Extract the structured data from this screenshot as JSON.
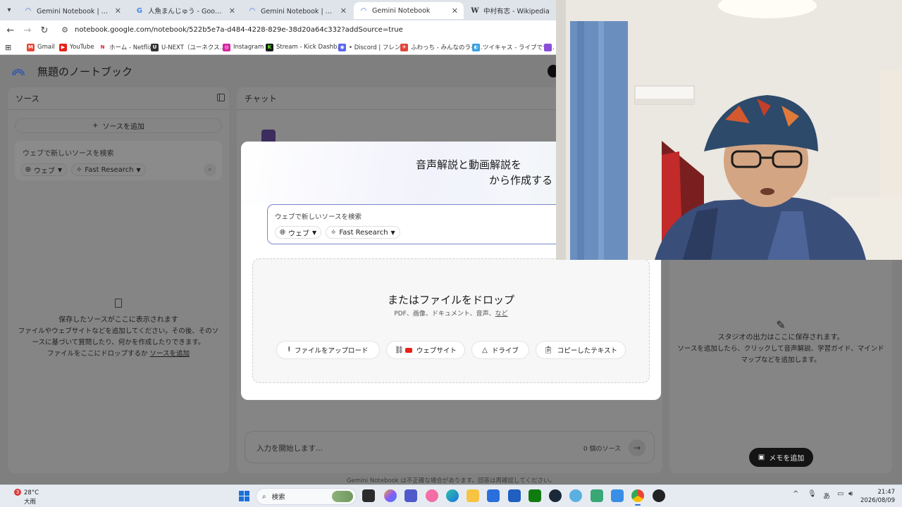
{
  "browser": {
    "tabs": [
      {
        "title": "Gemini Notebook | AI リサーチツ",
        "favicon": "notebook-icon",
        "active": false
      },
      {
        "title": "人魚まんじゅう - Google 検索",
        "favicon": "google-icon",
        "active": false
      },
      {
        "title": "Gemini Notebook | AI リサーチツ",
        "favicon": "notebook-icon",
        "active": false
      },
      {
        "title": "Gemini Notebook",
        "favicon": "notebook-icon",
        "active": true
      },
      {
        "title": "中村有志 - Wikipedia",
        "favicon": "wikipedia-icon",
        "active": false
      }
    ],
    "url": "notebook.google.com/notebook/522b5e7a-d484-4228-829e-38d20a64c332?addSource=true",
    "bookmarks": [
      {
        "label": "Gmail",
        "icon": "gmail-icon",
        "color": "#ea4335"
      },
      {
        "label": "YouTube",
        "icon": "youtube-icon",
        "color": "#e62117"
      },
      {
        "label": "ホーム - Netflix",
        "icon": "netflix-icon",
        "color": "#d81f26"
      },
      {
        "label": "U-NEXT（ユーネクス...",
        "icon": "unext-icon",
        "color": "#333333"
      },
      {
        "label": "Instagram",
        "icon": "instagram-icon",
        "color": "#d6249f"
      },
      {
        "label": "Stream - Kick Dashb...",
        "icon": "kick-icon",
        "color": "#1b1b1b"
      },
      {
        "label": "• Discord | フレンド",
        "icon": "discord-icon",
        "color": "#5865f2"
      },
      {
        "label": "ふわっち - みんなのライ...",
        "icon": "fuwacchi-icon",
        "color": "#e0463b"
      },
      {
        "label": "ツイキャス - ライブでつ...",
        "icon": "twitcasting-icon",
        "color": "#3aa0e0"
      }
    ]
  },
  "app": {
    "title": "無題のノートブック",
    "sources": {
      "title": "ソース",
      "add_button": "ソースを追加",
      "search_placeholder": "ウェブで新しいソースを検索",
      "web_chip": "ウェブ",
      "research_chip": "Fast Research",
      "empty_title": "保存したソースがここに表示されます",
      "empty_line1": "ファイルやウェブサイトなどを追加してください。その後、そのソ",
      "empty_line2": "ースに基づいて質問したり、何かを作成したりできます。",
      "empty_line3": "ファイルをここにドロップするか ",
      "empty_link": "ソースを追加"
    },
    "chat": {
      "title": "チャット",
      "input_placeholder": "入力を開始します...",
      "source_count": "0 個のソース"
    },
    "studio": {
      "empty_title": "スタジオの出力はここに保存されます。",
      "empty_line1": "ソースを追加したら、クリックして音声解説、学習ガイド、マインド",
      "empty_line2": "マップなどを追加します。",
      "note_button": "メモを追加"
    },
    "footer_note": "Gemini Notebook は不正確な場合があります。回答は再確認してください。"
  },
  "modal": {
    "heading_line1": "音声解説と動画解説を",
    "heading_line2": "から作成する",
    "search_placeholder": "ウェブで新しいソースを検索",
    "web_chip": "ウェブ",
    "research_chip": "Fast Research",
    "drop_title": "またはファイルをドロップ",
    "drop_subtitle": "PDF、画像、ドキュメント、音声、",
    "drop_subtitle_link": "など",
    "buttons": {
      "upload": "ファイルをアップロード",
      "website": "ウェブサイト",
      "drive": "ドライブ",
      "pasted_text": "コピーしたテキスト"
    }
  },
  "taskbar": {
    "weather_badge": "3",
    "temperature": "28°C",
    "condition": "大雨",
    "search_label": "検索",
    "time": "21:47",
    "date": "2026/08/09",
    "ime": "あ"
  }
}
